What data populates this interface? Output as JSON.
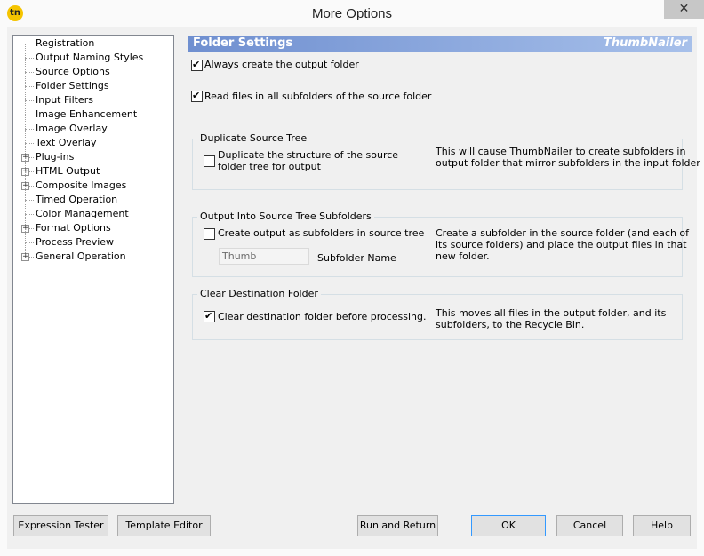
{
  "window": {
    "title": "More Options",
    "icon_text": "tn",
    "close_glyph": "✕"
  },
  "tree": {
    "items": [
      {
        "label": "Registration",
        "expandable": false
      },
      {
        "label": "Output Naming Styles",
        "expandable": false
      },
      {
        "label": "Source Options",
        "expandable": false
      },
      {
        "label": "Folder Settings",
        "expandable": false
      },
      {
        "label": "Input Filters",
        "expandable": false
      },
      {
        "label": "Image Enhancement",
        "expandable": false
      },
      {
        "label": "Image Overlay",
        "expandable": false
      },
      {
        "label": "Text Overlay",
        "expandable": false
      },
      {
        "label": "Plug-ins",
        "expandable": true
      },
      {
        "label": "HTML Output",
        "expandable": true
      },
      {
        "label": "Composite Images",
        "expandable": true
      },
      {
        "label": "Timed Operation",
        "expandable": false
      },
      {
        "label": "Color Management",
        "expandable": false
      },
      {
        "label": "Format Options",
        "expandable": true
      },
      {
        "label": "Process Preview",
        "expandable": false
      },
      {
        "label": "General Operation",
        "expandable": true
      }
    ],
    "expander_glyph": "+"
  },
  "panel": {
    "title": "Folder Settings",
    "brand": "ThumbNailer",
    "always_create": {
      "label": "Always create the output folder",
      "checked": true
    },
    "read_subfolders": {
      "label": "Read files in all subfolders of the source folder",
      "checked": true
    },
    "duplicate_group": {
      "title": "Duplicate Source Tree",
      "checkbox_line1": "Duplicate the structure of the source",
      "checkbox_line2": "folder tree for output",
      "checked": false,
      "desc_line1": "This will cause ThumbNailer to create subfolders in",
      "desc_line2": "output folder that mirror subfolders in the input folder"
    },
    "subfolders_group": {
      "title": "Output Into Source Tree Subfolders",
      "checkbox_label": "Create output as subfolders in source tree",
      "checked": false,
      "subfolder_value": "Thumb",
      "subfolder_label": "Subfolder Name",
      "desc_line1": "Create a subfolder in the source folder (and each of",
      "desc_line2": "its source folders) and place the output files in that",
      "desc_line3": "new folder."
    },
    "clear_group": {
      "title": "Clear Destination Folder",
      "checkbox_label": "Clear destination folder before processing.",
      "checked": true,
      "desc_line1": "This moves all files in the output folder, and its",
      "desc_line2": "subfolders, to the Recycle Bin."
    }
  },
  "buttons": {
    "expression_tester": "Expression Tester",
    "template_editor": "Template Editor",
    "run_and_return": "Run and Return",
    "ok": "OK",
    "cancel": "Cancel",
    "help": "Help"
  }
}
